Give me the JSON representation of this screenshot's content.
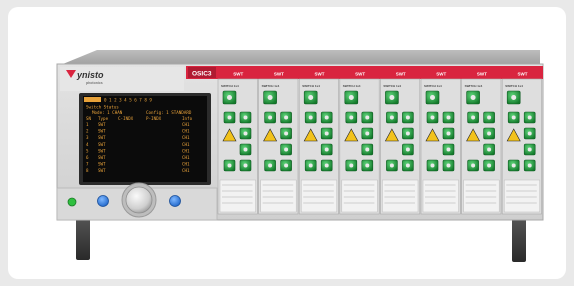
{
  "brand": {
    "name": "ynisto",
    "tagline": "photonics"
  },
  "header": {
    "chassis_label": "OSIC3"
  },
  "screen": {
    "tabs": [
      "0 1 2 3 4 5 6 7 8 9"
    ],
    "title": "Switch Status",
    "subheader": [
      "Mode: 1 CHAN",
      "Config: 1 STANDARD"
    ],
    "columns": [
      "SN",
      "Type",
      "C-INDX",
      "P-INDX",
      "Info"
    ],
    "rows": [
      {
        "sn": "1",
        "type": "SWT",
        "info": "CH1"
      },
      {
        "sn": "2",
        "type": "SWT",
        "info": "CH1"
      },
      {
        "sn": "3",
        "type": "SWT",
        "info": "CH1"
      },
      {
        "sn": "4",
        "type": "SWT",
        "info": "CH1"
      },
      {
        "sn": "5",
        "type": "SWT",
        "info": "CH1"
      },
      {
        "sn": "6",
        "type": "SWT",
        "info": "CH1"
      },
      {
        "sn": "7",
        "type": "SWT",
        "info": "CH1"
      },
      {
        "sn": "8",
        "type": "SWT",
        "info": "CH1"
      }
    ]
  },
  "modules": [
    {
      "slot_label": "SWT",
      "module_name": "SWITCH 1x4"
    },
    {
      "slot_label": "SWT",
      "module_name": "SWITCH 1x4"
    },
    {
      "slot_label": "SWT",
      "module_name": "SWITCH 1x4"
    },
    {
      "slot_label": "SWT",
      "module_name": "SWITCH 1x4"
    },
    {
      "slot_label": "SWT",
      "module_name": "SWITCH 1x4"
    },
    {
      "slot_label": "SWT",
      "module_name": "SWITCH 1x4"
    },
    {
      "slot_label": "SWT",
      "module_name": "SWITCH 1x4"
    },
    {
      "slot_label": "SWT",
      "module_name": "SWITCH 1x4"
    }
  ],
  "colors": {
    "accent_red": "#d9243f",
    "chassis": "#c9c9c9",
    "screen_bg": "#0b0b0b",
    "screen_text": "#e8a23a",
    "led_green": "#2fbf3f",
    "button_blue": "#2a7fe0",
    "connector_green": "#1f9a3a"
  }
}
